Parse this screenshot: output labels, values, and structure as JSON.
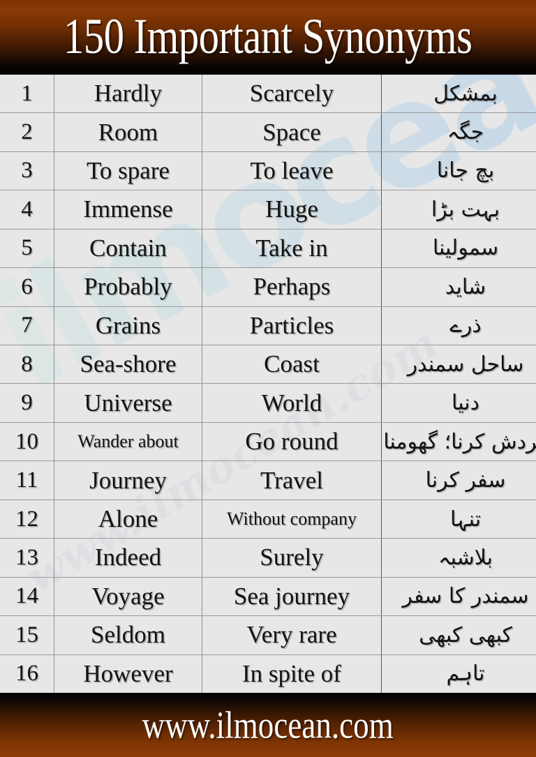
{
  "header": {
    "title": "150 Important Synonyms"
  },
  "footer": {
    "website": "www.ilmocean.com"
  },
  "watermark": {
    "big_text": "ilmocean",
    "script_text": "www.ilmocean.com"
  },
  "colors": {
    "header_brown": "#8a3a05",
    "header_black": "#020101",
    "cell_background": "#e7e7e7",
    "text": "#131313",
    "grid_line": "#9a9a9a",
    "watermark_blue": "#85bfe6",
    "watermark_teal": "#bfe6e2",
    "watermark_purple": "#cfc0d6"
  },
  "table": {
    "rows": [
      {
        "num": "1",
        "word": "Hardly",
        "synonym": "Scarcely",
        "urdu": "بمشکل",
        "word_small": false,
        "syn_small": false
      },
      {
        "num": "2",
        "word": "Room",
        "synonym": "Space",
        "urdu": "جگہ",
        "word_small": false,
        "syn_small": false
      },
      {
        "num": "3",
        "word": "To spare",
        "synonym": "To leave",
        "urdu": "بچ جانا",
        "word_small": false,
        "syn_small": false
      },
      {
        "num": "4",
        "word": "Immense",
        "synonym": "Huge",
        "urdu": "بہت بڑا",
        "word_small": false,
        "syn_small": false
      },
      {
        "num": "5",
        "word": "Contain",
        "synonym": "Take in",
        "urdu": "سمولینا",
        "word_small": false,
        "syn_small": false
      },
      {
        "num": "6",
        "word": "Probably",
        "synonym": "Perhaps",
        "urdu": "شاید",
        "word_small": false,
        "syn_small": false
      },
      {
        "num": "7",
        "word": "Grains",
        "synonym": "Particles",
        "urdu": "ذرے",
        "word_small": false,
        "syn_small": false
      },
      {
        "num": "8",
        "word": "Sea-shore",
        "synonym": "Coast",
        "urdu": "ساحل سمندر",
        "word_small": false,
        "syn_small": false
      },
      {
        "num": "9",
        "word": "Universe",
        "synonym": "World",
        "urdu": "دنیا",
        "word_small": false,
        "syn_small": false
      },
      {
        "num": "10",
        "word": "Wander about",
        "synonym": "Go round",
        "urdu": "گردش کرنا؛ گھومنا",
        "word_small": true,
        "syn_small": false
      },
      {
        "num": "11",
        "word": "Journey",
        "synonym": "Travel",
        "urdu": "سفر کرنا",
        "word_small": false,
        "syn_small": false
      },
      {
        "num": "12",
        "word": "Alone",
        "synonym": "Without company",
        "urdu": "تنہا",
        "word_small": false,
        "syn_small": true
      },
      {
        "num": "13",
        "word": "Indeed",
        "synonym": "Surely",
        "urdu": "بلاشبہ",
        "word_small": false,
        "syn_small": false
      },
      {
        "num": "14",
        "word": "Voyage",
        "synonym": "Sea journey",
        "urdu": "سمندر کا سفر",
        "word_small": false,
        "syn_small": false
      },
      {
        "num": "15",
        "word": "Seldom",
        "synonym": "Very rare",
        "urdu": "کبھی کبھی",
        "word_small": false,
        "syn_small": false
      },
      {
        "num": "16",
        "word": "However",
        "synonym": "In spite of",
        "urdu": "تاہم",
        "word_small": false,
        "syn_small": false
      }
    ]
  }
}
